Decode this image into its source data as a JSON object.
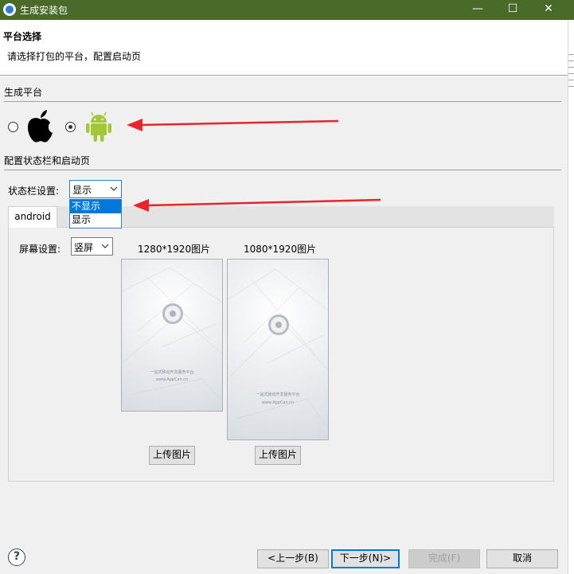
{
  "window": {
    "title": "生成安装包",
    "minimize": "—",
    "maximize": "☐",
    "close": "✕",
    "accent": "#4a6a2a"
  },
  "header": {
    "title": "平台选择",
    "subtitle": "请选择打包的平台，配置启动页"
  },
  "platform": {
    "group_label": "生成平台",
    "options": [
      {
        "icon": "apple-icon",
        "checked": false
      },
      {
        "icon": "android-icon",
        "checked": true
      }
    ]
  },
  "config": {
    "group_label": "配置状态栏和启动页",
    "statusbar_label": "状态栏设置:",
    "statusbar_value": "显示",
    "statusbar_options": [
      "不显示",
      "显示"
    ],
    "statusbar_highlighted": "不显示"
  },
  "tabs": [
    {
      "label": "android",
      "active": true
    }
  ],
  "screen": {
    "label": "屏幕设置:",
    "value": "竖屏"
  },
  "images": [
    {
      "caption": "1280*1920图片",
      "slogan": "一站式移动开发服务平台",
      "site": "www.AppCan.cn",
      "upload_label": "上传图片"
    },
    {
      "caption": "1080*1920图片",
      "slogan": "一站式移动开发服务平台",
      "site": "www.AppCan.cn",
      "upload_label": "上传图片"
    }
  ],
  "footer": {
    "help": "?",
    "back": "<上一步(B)",
    "next": "下一步(N)>",
    "finish": "完成(F)",
    "cancel": "取消"
  },
  "colors": {
    "annotation_arrow": "#e8252a",
    "android_green": "#a4c639",
    "focus_blue": "#2b7fd4"
  }
}
